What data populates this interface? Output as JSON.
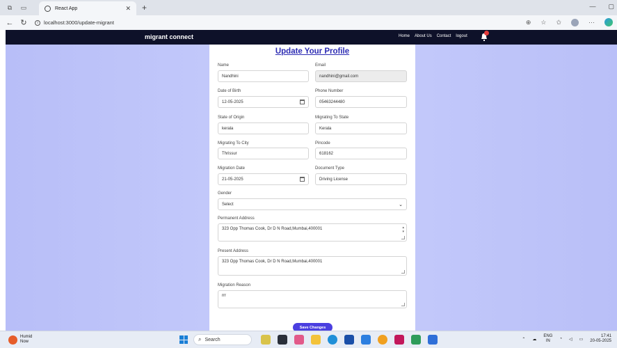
{
  "browser": {
    "tab_title": "React App",
    "url": "localhost:3000/update-migrant"
  },
  "app": {
    "brand": "migrant connect",
    "nav": [
      "Home",
      "About Us",
      "Contact",
      "logout"
    ]
  },
  "form": {
    "heading": "Update Your Profile",
    "name_label": "Name",
    "name_value": "Nandhini",
    "email_label": "Email",
    "email_value": "nandhini@gmail.com",
    "dob_label": "Date of Birth",
    "dob_value": "12-05-2025",
    "phone_label": "Phone Number",
    "phone_value": "05463244480",
    "origin_label": "State of Origin",
    "origin_value": "kerala",
    "mig_state_label": "Migrating To State",
    "mig_state_value": "Kerala",
    "mig_city_label": "Migrating To City",
    "mig_city_value": "Thrissur",
    "pincode_label": "Pincode",
    "pincode_value": "618162",
    "mig_date_label": "Migration Date",
    "mig_date_value": "21-05-2025",
    "doc_label": "Document Type",
    "doc_value": "Driving License",
    "gender_label": "Gender",
    "gender_value": "Select",
    "perm_label": "Permanent Address",
    "perm_value": "323 Opp Thomas Cook, Dr D N Road,Mumbai,400001",
    "present_label": "Present Address",
    "present_value": "323 Opp Thomas Cook, Dr D N Road,Mumbai,400001",
    "reason_label": "Migration Reason",
    "reason_value": "rrr",
    "save_label": "Save Changes"
  },
  "taskbar": {
    "weather_title": "Humid",
    "weather_sub": "Now",
    "search_placeholder": "Search",
    "lang": "ENG",
    "region": "IN",
    "time": "17:41",
    "date": "20-05-2025"
  },
  "colors": {
    "navbar": "#0e1129",
    "heading": "#2d2cb3",
    "button": "#4b3fe0",
    "background": "#c3c9fa"
  }
}
